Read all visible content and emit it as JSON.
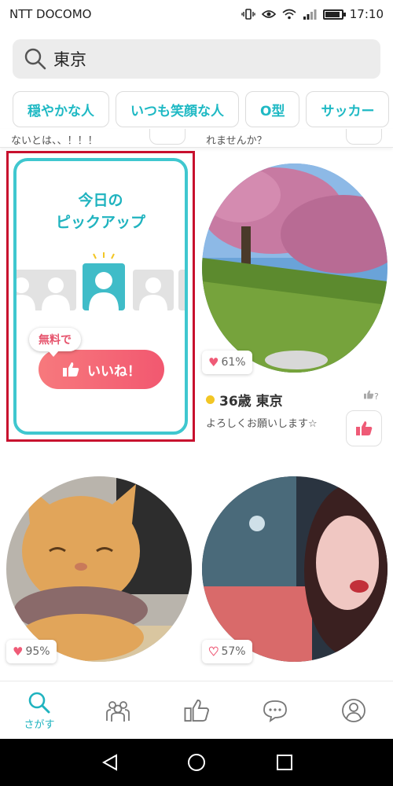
{
  "status_bar": {
    "carrier": "NTT DOCOMO",
    "time": "17:10",
    "battery_level": 0.85,
    "icons": [
      "vibrate-icon",
      "eye-icon",
      "wifi-icon",
      "signal-icon",
      "battery-icon"
    ]
  },
  "search": {
    "value": "東京",
    "icon": "search-icon"
  },
  "tags": [
    "穏やかな人",
    "いつも笑顔な人",
    "O型",
    "サッカー"
  ],
  "cutoff": {
    "left_text": "ないとは、、！！！",
    "right_text": "れませんか？"
  },
  "pickup": {
    "title_line1": "今日の",
    "title_line2": "ピックアップ",
    "free_label": "無料で",
    "like_label": "いいね！"
  },
  "profiles": [
    {
      "match": "61%",
      "age": "36歳",
      "location": "東京",
      "message": "よろしくお願いします☆",
      "like_question": "?",
      "online": true
    },
    {
      "match": "95%"
    },
    {
      "match": "57%"
    }
  ],
  "bottom_nav": {
    "items": [
      {
        "icon": "search-icon",
        "label": "さがす",
        "active": true
      },
      {
        "icon": "community-icon",
        "label": ""
      },
      {
        "icon": "thumbs-up-icon",
        "label": ""
      },
      {
        "icon": "chat-icon",
        "label": ""
      },
      {
        "icon": "profile-icon",
        "label": ""
      }
    ]
  },
  "colors": {
    "accent": "#1fb3bf",
    "like_pink": "#f25870",
    "highlight_red": "#c8102e"
  }
}
